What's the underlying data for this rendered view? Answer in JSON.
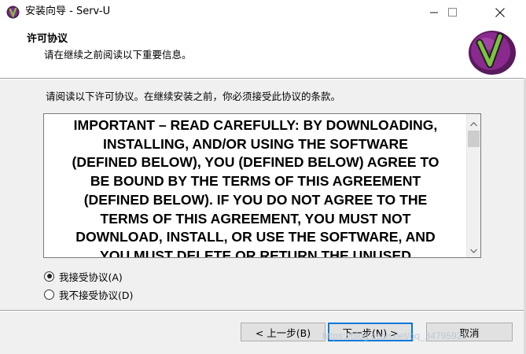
{
  "window": {
    "title": "安装向导 - Serv-U",
    "minimize_icon": "minimize-icon",
    "maximize_icon": "maximize-icon",
    "close_icon": "close-icon"
  },
  "header": {
    "title": "许可协议",
    "subtitle": "请在继续之前阅读以下重要信息。",
    "logo_icon": "serv-u-logo"
  },
  "body": {
    "instruction": "请阅读以下许可协议。在继续安装之前，你必须接受此协议的条款。",
    "license_text": "IMPORTANT – READ CAREFULLY:  BY DOWNLOADING,\nINSTALLING, AND/OR USING THE SOFTWARE\n(DEFINED BELOW), YOU (DEFINED BELOW) AGREE TO\nBE BOUND BY THE TERMS OF THIS AGREEMENT\n(DEFINED BELOW).  IF YOU DO NOT AGREE TO THE\nTERMS OF THIS AGREEMENT, YOU MUST NOT\nDOWNLOAD, INSTALL, OR USE THE SOFTWARE, AND\nYOU MUST DELETE OR RETURN THE UNUSED"
  },
  "options": {
    "accept_label": "我接受协议(A)",
    "decline_label": "我不接受协议(D)",
    "selected": "accept"
  },
  "buttons": {
    "back_label": "< 上一步(B)",
    "next_label": "下一步(N) >",
    "cancel_label": "取消"
  },
  "watermark": "https://blog.csdn.net/qq_34795929",
  "colors": {
    "accent": "#0078d7",
    "logo_purple": "#8a2a8e",
    "logo_green": "#7ec242"
  }
}
